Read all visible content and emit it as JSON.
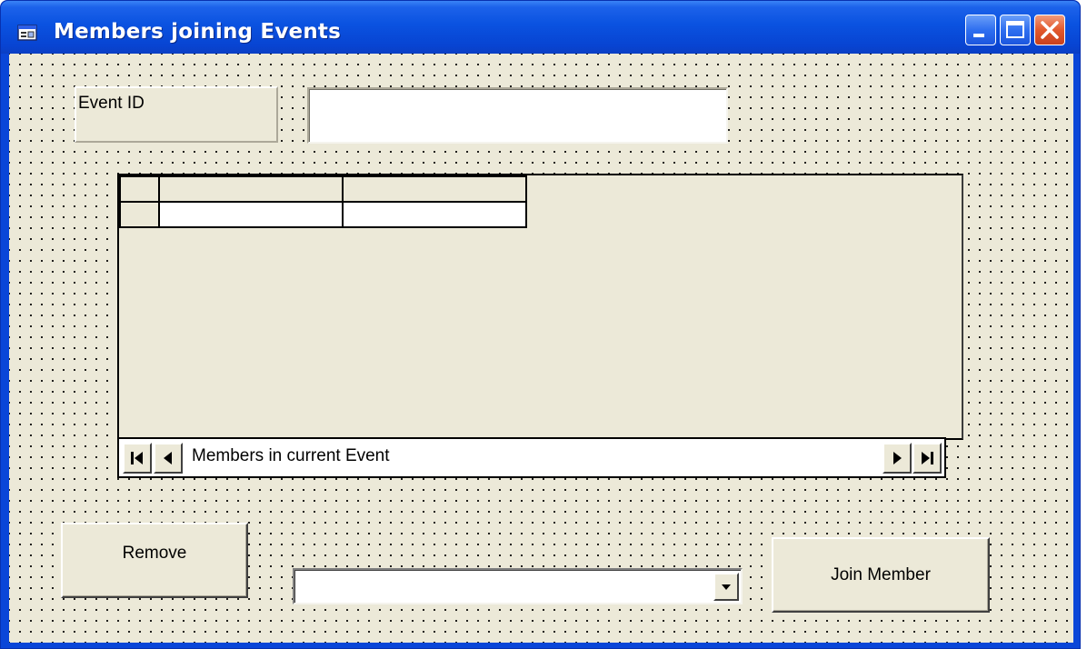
{
  "window": {
    "title": "Members joining Events",
    "icons": {
      "app": "form-icon",
      "minimize": "minimize-icon",
      "maximize": "maximize-icon",
      "close": "close-icon"
    }
  },
  "form": {
    "event_label": "Event ID",
    "event_value": ""
  },
  "grid": {
    "columns": [
      "",
      ""
    ],
    "rows": [
      [
        "",
        ""
      ]
    ]
  },
  "navigator": {
    "caption": "Members in current Event",
    "icons": {
      "first": "first-record-icon",
      "prev": "previous-record-icon",
      "next": "next-record-icon",
      "last": "last-record-icon"
    }
  },
  "buttons": {
    "remove": "Remove",
    "join": "Join Member"
  },
  "combo": {
    "selected": "",
    "icon": "dropdown-arrow-icon"
  },
  "colors": {
    "titlebar": "#0a52e0",
    "face": "#ece9d8",
    "close": "#e2582c"
  }
}
